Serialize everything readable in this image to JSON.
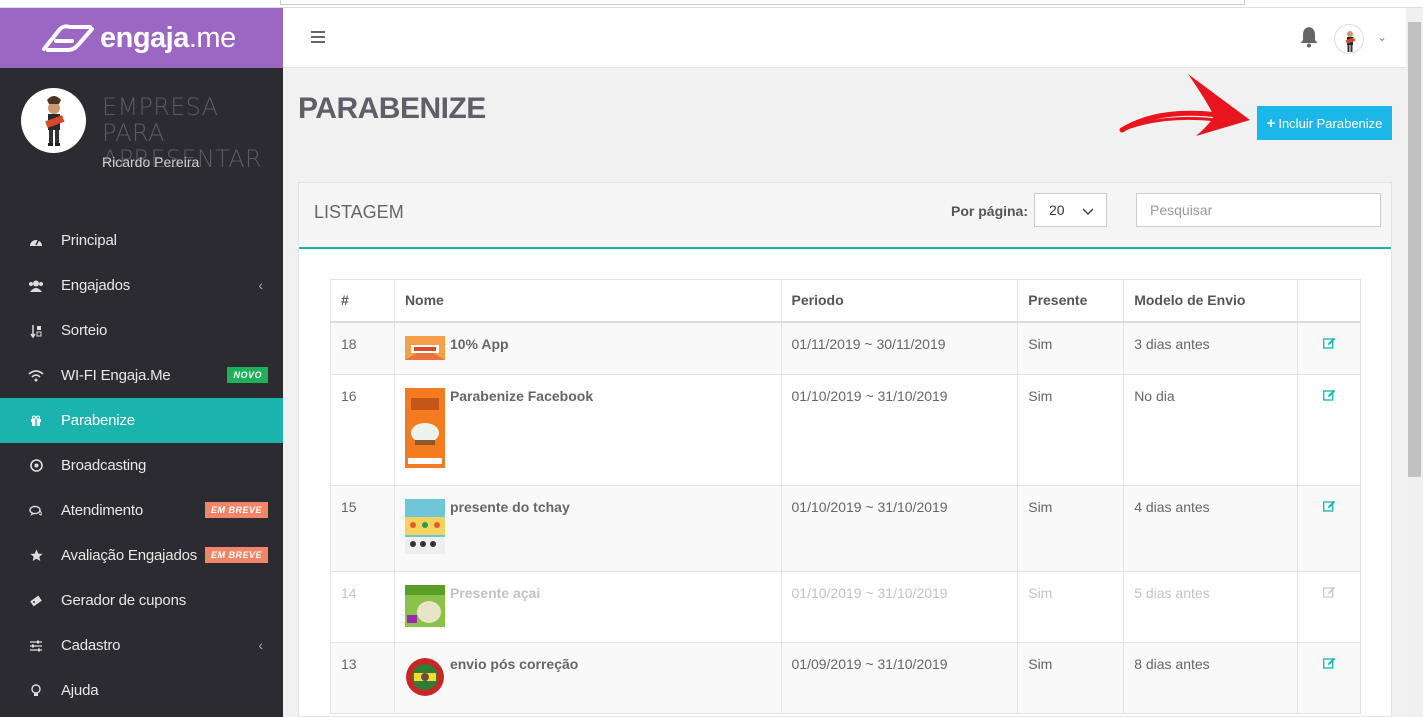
{
  "brand": {
    "name": "engaja",
    "suffix": ".me"
  },
  "profile": {
    "company_line1": "EMPRESA PARA",
    "company_line2": "APRESENTAR",
    "user": "Ricardo Pereira"
  },
  "nav": [
    {
      "label": "Principal",
      "icon": "dashboard-icon"
    },
    {
      "label": "Engajados",
      "icon": "users-icon",
      "chevron": "‹"
    },
    {
      "label": "Sorteio",
      "icon": "sort-icon"
    },
    {
      "label": "WI-FI Engaja.Me",
      "icon": "wifi-icon",
      "badge": "NOVO"
    },
    {
      "label": "Parabenize",
      "icon": "gift-icon",
      "active": true
    },
    {
      "label": "Broadcasting",
      "icon": "broadcast-icon"
    },
    {
      "label": "Atendimento",
      "icon": "chat-icon",
      "badge": "EM BREVE"
    },
    {
      "label": "Avaliação Engajados",
      "icon": "star-icon",
      "badge": "EM BREVE"
    },
    {
      "label": "Gerador de cupons",
      "icon": "ticket-icon"
    },
    {
      "label": "Cadastro",
      "icon": "sliders-icon",
      "chevron": "‹"
    },
    {
      "label": "Ajuda",
      "icon": "bulb-icon"
    }
  ],
  "header": {
    "menu_icon": "hamburger-icon",
    "bell_icon": "bell-icon",
    "caret": "⌄"
  },
  "page": {
    "title": "PARABENIZE",
    "add_button": "Incluir Parabenize",
    "add_icon": "+"
  },
  "listing": {
    "title": "LISTAGEM",
    "per_page_label": "Por página:",
    "per_page_value": "20",
    "search_placeholder": "Pesquisar",
    "columns": [
      "#",
      "Nome",
      "Periodo",
      "Presente",
      "Modelo de Envio",
      ""
    ],
    "rows": [
      {
        "id": "18",
        "name": "10% App",
        "period": "01/11/2019 ~ 30/11/2019",
        "gift": "Sim",
        "send": "3 dias antes"
      },
      {
        "id": "16",
        "name": "Parabenize Facebook",
        "period": "01/10/2019 ~ 31/10/2019",
        "gift": "Sim",
        "send": "No dia"
      },
      {
        "id": "15",
        "name": "presente do tchay",
        "period": "01/10/2019 ~ 31/10/2019",
        "gift": "Sim",
        "send": "4 dias antes"
      },
      {
        "id": "14",
        "name": "Presente açai",
        "period": "01/10/2019 ~ 31/10/2019",
        "gift": "Sim",
        "send": "5 dias antes"
      },
      {
        "id": "13",
        "name": "envio pós correção",
        "period": "01/09/2019 ~ 31/10/2019",
        "gift": "Sim",
        "send": "8 dias antes"
      }
    ]
  },
  "colors": {
    "brand": "#9b67c3",
    "accent": "#1ab3ae",
    "button": "#1ab7e8",
    "sidebar": "#2b2b31"
  }
}
